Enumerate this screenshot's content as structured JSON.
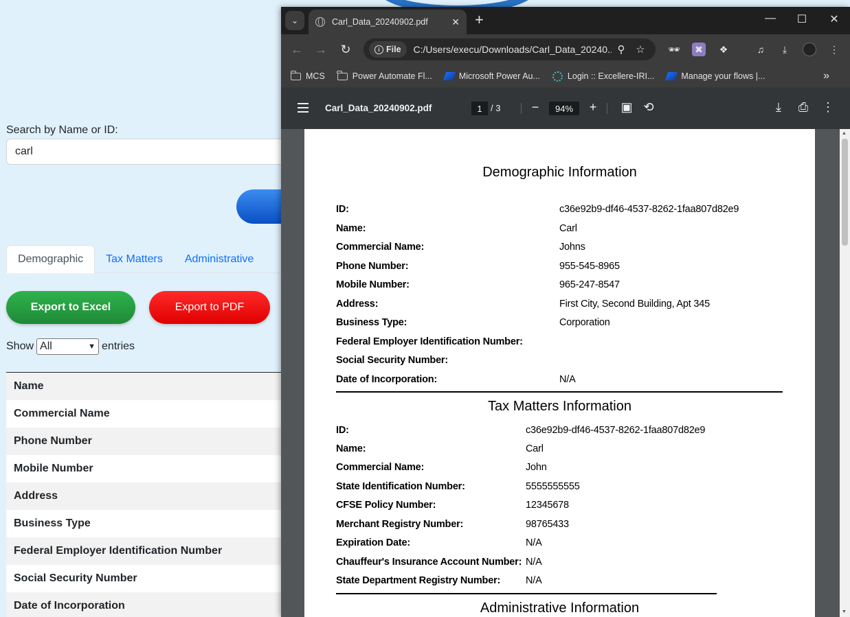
{
  "app": {
    "search_label": "Search by Name or ID:",
    "search_value": "carl",
    "tabs": [
      {
        "label": "Demographic"
      },
      {
        "label": "Tax Matters"
      },
      {
        "label": "Administrative"
      }
    ],
    "export_excel": "Export to Excel",
    "export_pdf": "Export to PDF",
    "show_label": "Show",
    "show_value": "All",
    "entries_label": "entries",
    "rows": [
      "Name",
      "Commercial Name",
      "Phone Number",
      "Mobile Number",
      "Address",
      "Business Type",
      "Federal Employer Identification Number",
      "Social Security Number",
      "Date of Incorporation"
    ]
  },
  "browser": {
    "tab_title": "Carl_Data_20240902.pdf",
    "address_chip": "File",
    "url": "C:/Users/execu/Downloads/Carl_Data_20240...",
    "bookmarks": [
      {
        "label": "MCS",
        "icon": "folder-icon"
      },
      {
        "label": "Power Automate Fl...",
        "icon": "folder-icon"
      },
      {
        "label": "Microsoft Power Au...",
        "icon": "power-automate-icon"
      },
      {
        "label": "Login :: Excellere-IRI...",
        "icon": "openai-icon"
      },
      {
        "label": "Manage your flows |...",
        "icon": "power-automate-icon"
      }
    ]
  },
  "pdf": {
    "filename": "Carl_Data_20240902.pdf",
    "page_current": "1",
    "page_total": "/  3",
    "zoom": "94%",
    "demographic": {
      "title": "Demographic Information",
      "fields": [
        {
          "label": "ID:",
          "value": "c36e92b9-df46-4537-8262-1faa807d82e9"
        },
        {
          "label": "Name:",
          "value": "Carl"
        },
        {
          "label": "Commercial Name:",
          "value": "Johns"
        },
        {
          "label": "Phone Number:",
          "value": "955-545-8965"
        },
        {
          "label": "Mobile Number:",
          "value": "965-247-8547"
        },
        {
          "label": "Address:",
          "value": "First City, Second Building, Apt 345"
        },
        {
          "label": "Business Type:",
          "value": "Corporation"
        },
        {
          "label": "Federal Employer Identification Number:",
          "value": ""
        },
        {
          "label": "Social Security Number:",
          "value": ""
        },
        {
          "label": "Date of Incorporation:",
          "value": "N/A"
        }
      ]
    },
    "tax": {
      "title": "Tax Matters Information",
      "fields": [
        {
          "label": "ID:",
          "value": "c36e92b9-df46-4537-8262-1faa807d82e9"
        },
        {
          "label": "Name:",
          "value": "Carl"
        },
        {
          "label": "Commercial Name:",
          "value": "John"
        },
        {
          "label": "State Identification Number:",
          "value": "5555555555"
        },
        {
          "label": "CFSE Policy Number:",
          "value": "12345678"
        },
        {
          "label": "Merchant Registry Number:",
          "value": "98765433"
        },
        {
          "label": "Expiration Date:",
          "value": "N/A"
        },
        {
          "label": "Chauffeur's Insurance Account Number:",
          "value": "N/A"
        },
        {
          "label": "State Department Registry Number:",
          "value": "N/A"
        }
      ]
    },
    "administrative": {
      "title": "Administrative Information"
    }
  }
}
